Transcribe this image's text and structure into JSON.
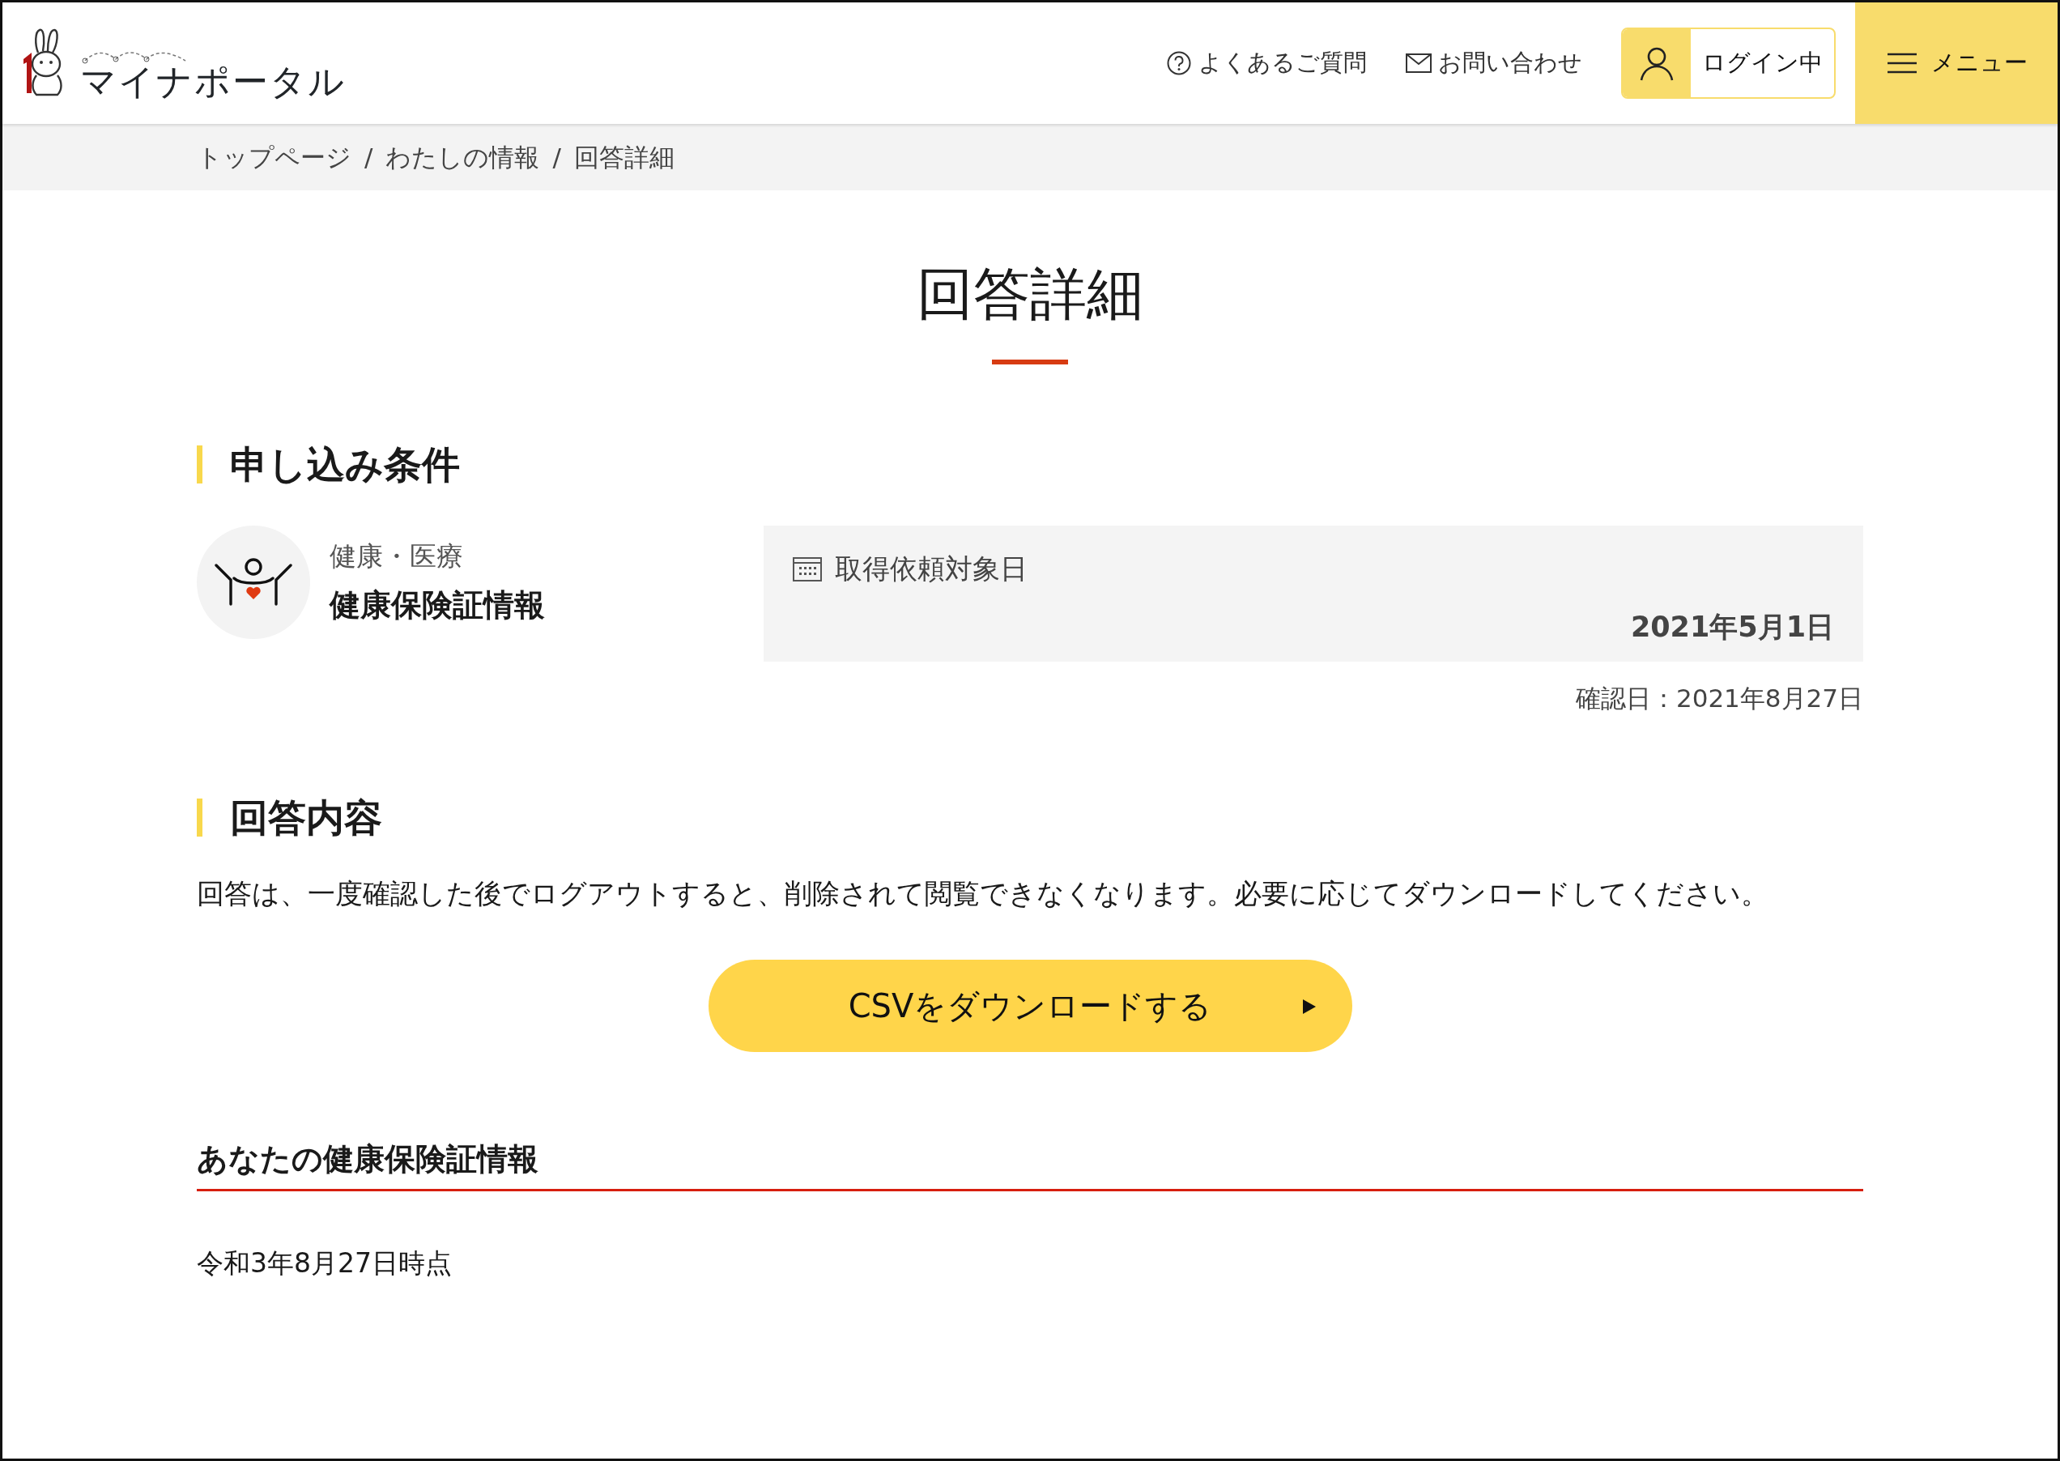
{
  "header": {
    "logo_text": "マイナポータル",
    "links": [
      {
        "label": "よくあるご質問",
        "kind": "help"
      },
      {
        "label": "お問い合わせ",
        "kind": "mail"
      }
    ],
    "login_label": "ログイン中",
    "menu_label": "メニュー"
  },
  "breadcrumb": {
    "separator": "/",
    "items": [
      "トップページ",
      "わたしの情報",
      "回答詳細"
    ]
  },
  "page_title": "回答詳細",
  "conditions": {
    "heading": "申し込み条件",
    "category": "健康・医療",
    "name": "健康保険証情報",
    "date_label": "取得依頼対象日",
    "date_value": "2021年5月1日",
    "confirmed": "確認日：2021年8月27日"
  },
  "answer": {
    "heading": "回答内容",
    "notice": "回答は、一度確認した後でログアウトすると、削除されて閲覧できなくなります。必要に応じてダウンロードしてください。",
    "download_button": "CSVをダウンロードする",
    "subheading": "あなたの健康保険証情報",
    "as_of": "令和3年8月27日時点"
  }
}
